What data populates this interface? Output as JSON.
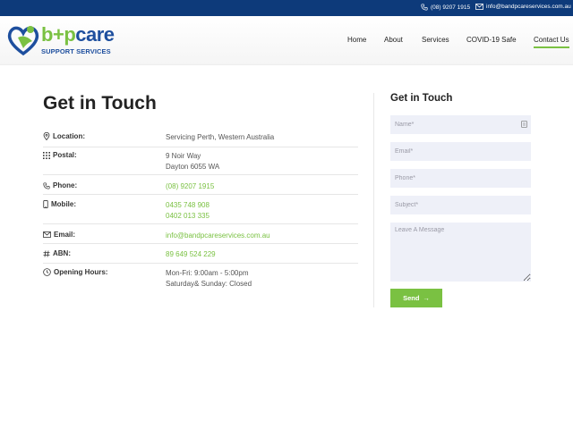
{
  "topbar": {
    "phone": "(08) 9207 1915",
    "email": "info@bandpcareservices.com.au"
  },
  "brand": {
    "b": "b",
    "plus": "+",
    "p": "p",
    "care": "care",
    "tagline": "SUPPORT SERVICES"
  },
  "nav": {
    "items": [
      "Home",
      "About",
      "Services",
      "COVID-19 Safe",
      "Contact Us"
    ],
    "active": "Contact Us"
  },
  "contact": {
    "heading": "Get in Touch",
    "rows": [
      {
        "label": "Location:",
        "icon": "location-pin-icon",
        "lines": [
          "Servicing Perth, Western Australia"
        ]
      },
      {
        "label": "Postal:",
        "icon": "grid-dots-icon",
        "lines": [
          "9 Noir Way",
          "Dayton 6055 WA"
        ]
      },
      {
        "label": "Phone:",
        "icon": "phone-icon",
        "lines": [
          "(08) 9207 1915"
        ]
      },
      {
        "label": "Mobile:",
        "icon": "mobile-icon",
        "lines": [
          "0435 748 908",
          "0402 013 335"
        ]
      },
      {
        "label": "Email:",
        "icon": "envelope-icon",
        "lines": [
          "info@bandpcareservices.com.au"
        ]
      },
      {
        "label": "ABN:",
        "icon": "hash-icon",
        "lines": [
          "89 649 524 229"
        ]
      },
      {
        "label": "Opening Hours:",
        "icon": "clock-icon",
        "lines": [
          "Mon-Fri: 9:00am - 5:00pm",
          "Saturday& Sunday: Closed"
        ]
      }
    ]
  },
  "form": {
    "heading": "Get in Touch",
    "name_placeholder": "Name*",
    "email_placeholder": "Email*",
    "phone_placeholder": "Phone*",
    "subject_placeholder": "Subject*",
    "message_placeholder": "Leave A Message",
    "send_label": "Send",
    "send_arrow": "→"
  },
  "colors": {
    "topbar": "#0d3a7a",
    "brand_blue": "#1e4f9e",
    "accent_green": "#7ac142",
    "field_bg": "#eef0f8"
  }
}
